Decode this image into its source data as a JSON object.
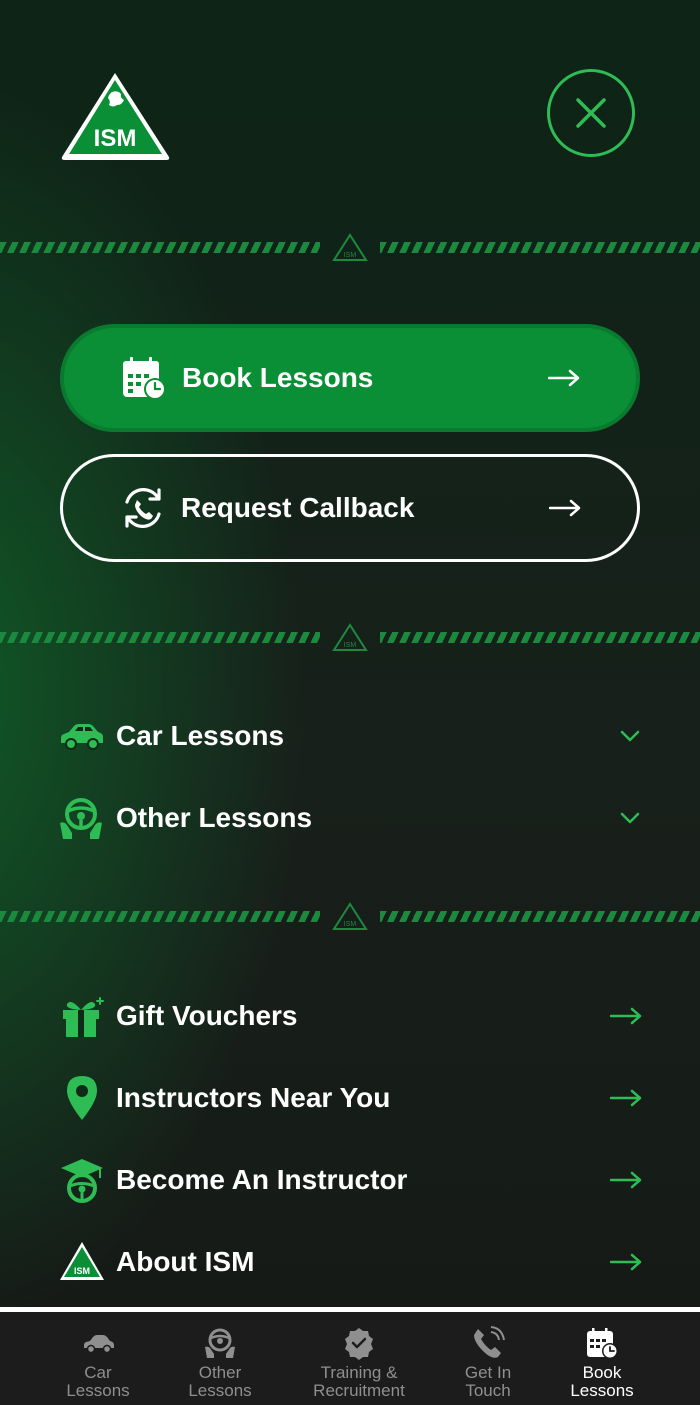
{
  "header": {
    "logo_text": "ISM",
    "logo_icon": "ism-triangle-logo-icon",
    "close_icon": "close-icon"
  },
  "cta": {
    "book": {
      "label": "Book Lessons",
      "icon": "calendar-clock-icon"
    },
    "callback": {
      "label": "Request Callback",
      "icon": "phone-refresh-icon"
    }
  },
  "accordion": [
    {
      "label": "Car Lessons",
      "icon": "car-icon"
    },
    {
      "label": "Other Lessons",
      "icon": "steering-wheel-hands-icon"
    }
  ],
  "links": [
    {
      "label": "Gift Vouchers",
      "icon": "gift-icon"
    },
    {
      "label": "Instructors Near You",
      "icon": "map-pin-icon"
    },
    {
      "label": "Become An Instructor",
      "icon": "graduation-wheel-icon"
    },
    {
      "label": "About ISM",
      "icon": "ism-triangle-icon"
    }
  ],
  "bottom_nav": [
    {
      "label": "Car\nLessons",
      "icon": "car-icon",
      "active": false
    },
    {
      "label": "Other\nLessons",
      "icon": "steering-wheel-hands-icon",
      "active": false
    },
    {
      "label": "Training &\nRecruitment",
      "icon": "verified-badge-icon",
      "active": false
    },
    {
      "label": "Get In\nTouch",
      "icon": "phone-icon",
      "active": false
    },
    {
      "label": "Book\nLessons",
      "icon": "calendar-clock-icon",
      "active": true
    }
  ],
  "colors": {
    "accent": "#2ebc55",
    "cta_fill": "#0b8f36",
    "stripe": "#1c8a3e",
    "nav_bg": "#1c1c1c"
  }
}
